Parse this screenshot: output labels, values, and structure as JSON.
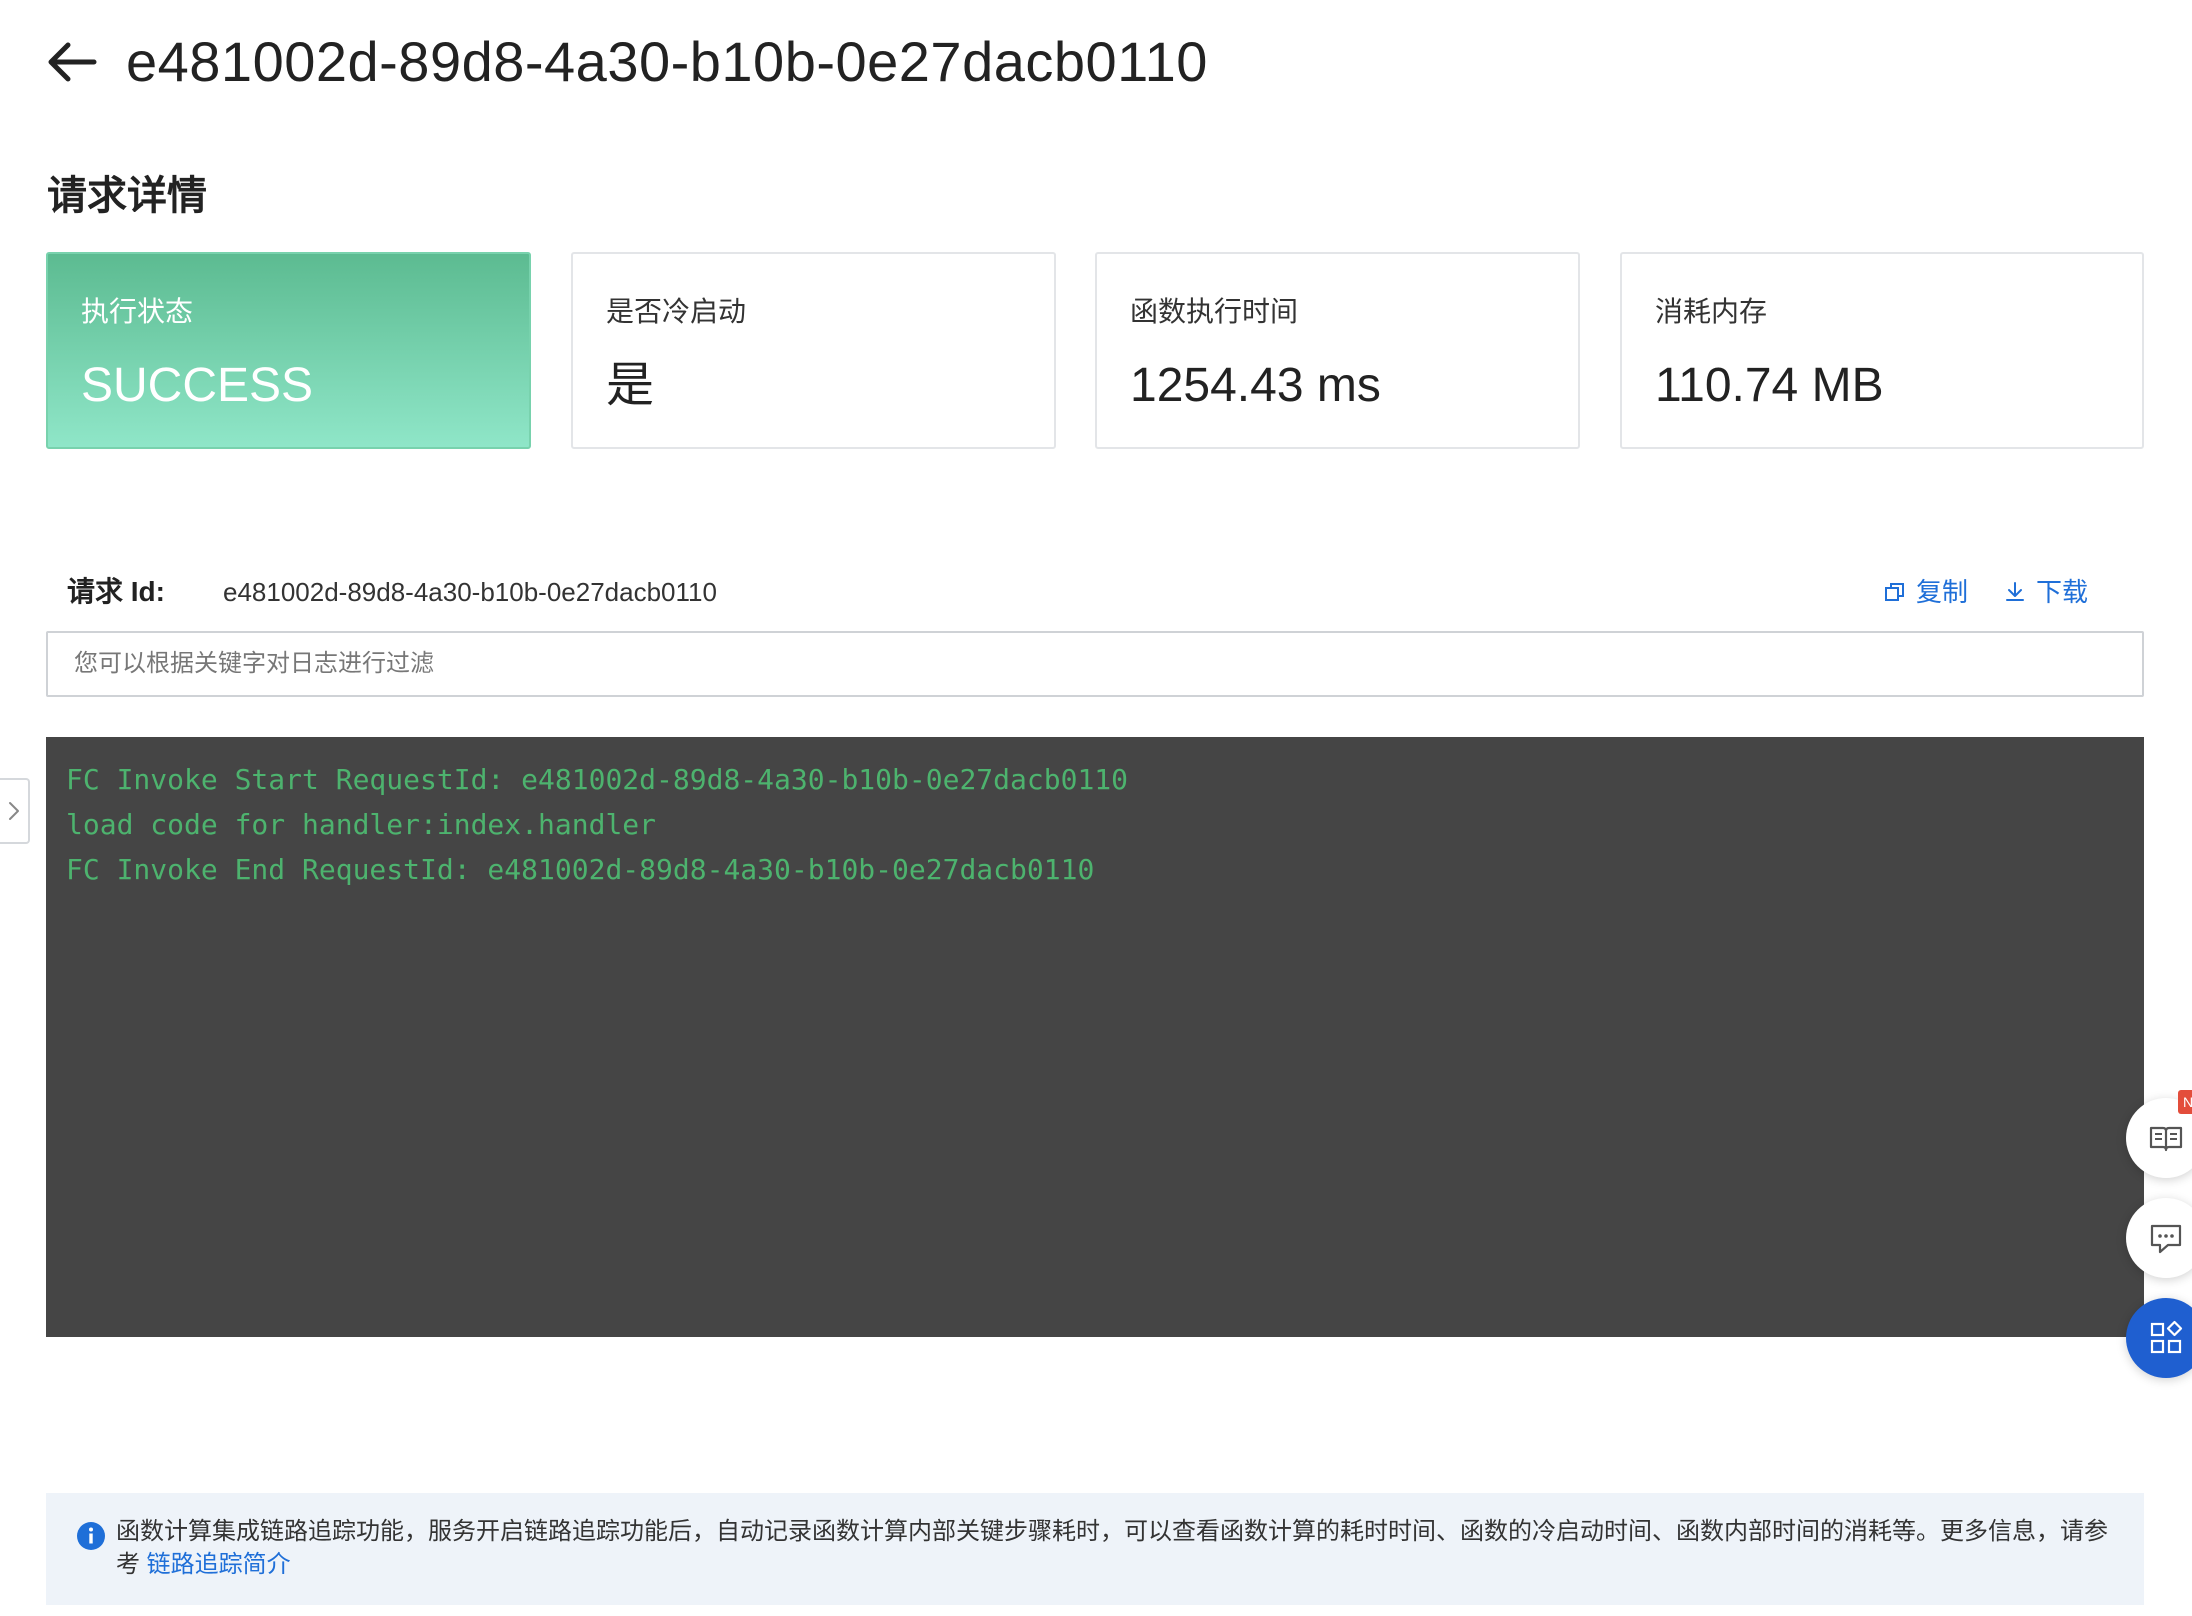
{
  "header": {
    "title": "e481002d-89d8-4a30-b10b-0e27dacb0110",
    "back_icon": "arrow-left-icon"
  },
  "section_title": "请求详情",
  "cards": [
    {
      "label": "执行状态",
      "value": "SUCCESS"
    },
    {
      "label": "是否冷启动",
      "value": "是"
    },
    {
      "label": "函数执行时间",
      "value": "1254.43 ms"
    },
    {
      "label": "消耗内存",
      "value": "110.74 MB"
    }
  ],
  "request": {
    "label": "请求 Id:",
    "value": "e481002d-89d8-4a30-b10b-0e27dacb0110",
    "copy_label": "复制",
    "download_label": "下载"
  },
  "filter": {
    "placeholder": "您可以根据关键字对日志进行过滤"
  },
  "log": {
    "lines": [
      "FC Invoke Start RequestId: e481002d-89d8-4a30-b10b-0e27dacb0110",
      "load code for handler:index.handler",
      "FC Invoke End RequestId: e481002d-89d8-4a30-b10b-0e27dacb0110"
    ]
  },
  "floating": {
    "badge": "N"
  },
  "info": {
    "text": "函数计算集成链路追踪功能，服务开启链路追踪功能后，自动记录函数计算内部关键步骤耗时，可以查看函数计算的耗时时间、函数的冷启动时间、函数内部时间的消耗等。更多信息，请参考 ",
    "link": "链路追踪简介"
  },
  "colors": {
    "success_card_top": "#5cbb91",
    "success_card_bottom": "#8fe6c8",
    "link": "#1f6fd8",
    "log_bg": "#454545",
    "log_text": "#4db36e",
    "apps_button": "#1f5fd0"
  }
}
